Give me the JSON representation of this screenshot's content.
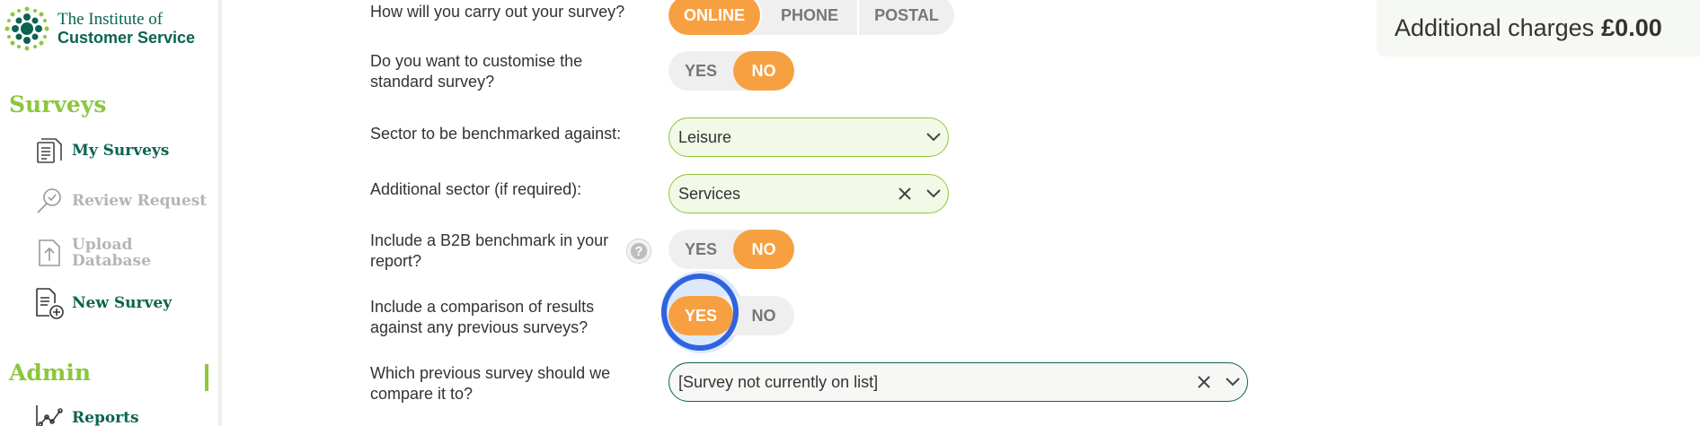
{
  "brand": {
    "line1": "The Institute of",
    "line2": "Customer Service",
    "accent": "#0b6451",
    "green": "#8dc63f",
    "orange": "#f7a042"
  },
  "sidebar": {
    "surveys_title": "Surveys",
    "admin_title": "Admin",
    "items": [
      {
        "label": "My Surveys",
        "icon": "documents-icon",
        "state": "active"
      },
      {
        "label": "Review Request",
        "icon": "magnifier-check-icon",
        "state": "disabled"
      },
      {
        "label_line1": "Upload",
        "label_line2": "Database",
        "icon": "upload-file-icon",
        "state": "disabled"
      },
      {
        "label": "New Survey",
        "icon": "new-document-plus-icon",
        "state": "active"
      },
      {
        "label": "Reports",
        "icon": "line-chart-icon",
        "state": "active"
      }
    ]
  },
  "charges": {
    "label": "Additional charges",
    "amount": "£0.00"
  },
  "form": {
    "q_method": "How will you carry out your survey?",
    "method_options": [
      "ONLINE",
      "PHONE",
      "POSTAL"
    ],
    "method_selected": "ONLINE",
    "q_customise": "Do you want to customise the standard survey?",
    "customise_options": [
      "YES",
      "NO"
    ],
    "customise_selected": "NO",
    "q_sector": "Sector to be benchmarked against:",
    "sector_value": "Leisure",
    "q_additional": "Additional sector (if required):",
    "additional_value": "Services",
    "q_b2b": "Include a B2B benchmark in your report?",
    "b2b_options": [
      "YES",
      "NO"
    ],
    "b2b_selected": "NO",
    "help_glyph": "?",
    "q_compare": "Include a comparison of results against any previous surveys?",
    "compare_options": [
      "YES",
      "NO"
    ],
    "compare_selected": "YES",
    "q_which": "Which previous survey should we compare it to?",
    "which_value": "[Survey not currently on list]"
  }
}
